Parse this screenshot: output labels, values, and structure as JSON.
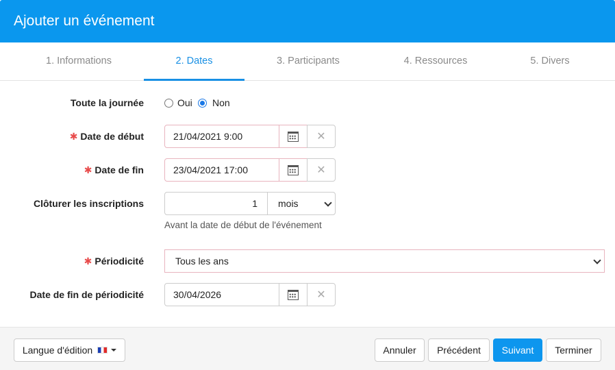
{
  "header": {
    "title": "Ajouter un événement"
  },
  "tabs": [
    {
      "label": "1. Informations",
      "active": false
    },
    {
      "label": "2. Dates",
      "active": true
    },
    {
      "label": "3. Participants",
      "active": false
    },
    {
      "label": "4. Ressources",
      "active": false
    },
    {
      "label": "5. Divers",
      "active": false
    }
  ],
  "form": {
    "all_day": {
      "label": "Toute la journée",
      "options": [
        "Oui",
        "Non"
      ],
      "selected": "Non"
    },
    "start_date": {
      "label": "Date de début",
      "required": true,
      "value": "21/04/2021 9:00"
    },
    "end_date": {
      "label": "Date de fin",
      "required": true,
      "value": "23/04/2021 17:00"
    },
    "close_registration": {
      "label": "Clôturer les inscriptions",
      "value": "1",
      "unit": "mois",
      "help": "Avant la date de début de l'événement"
    },
    "recurrence": {
      "label": "Périodicité",
      "required": true,
      "value": "Tous les ans"
    },
    "recurrence_end": {
      "label": "Date de fin de périodicité",
      "value": "30/04/2026"
    },
    "required_marker": "✱",
    "clear_glyph": "✕"
  },
  "footer": {
    "language_label": "Langue d'édition",
    "cancel_label": "Annuler",
    "previous_label": "Précédent",
    "next_label": "Suivant",
    "finish_label": "Terminer"
  },
  "colors": {
    "primary": "#0a97ee",
    "active_tab": "#1990e4",
    "required": "#e84c4c",
    "invalid_border": "#e8b4be"
  },
  "icons": {
    "calendar": "calendar-icon",
    "clear": "close-icon",
    "chevron": "chevron-down-icon",
    "flag": "france-flag-icon"
  }
}
